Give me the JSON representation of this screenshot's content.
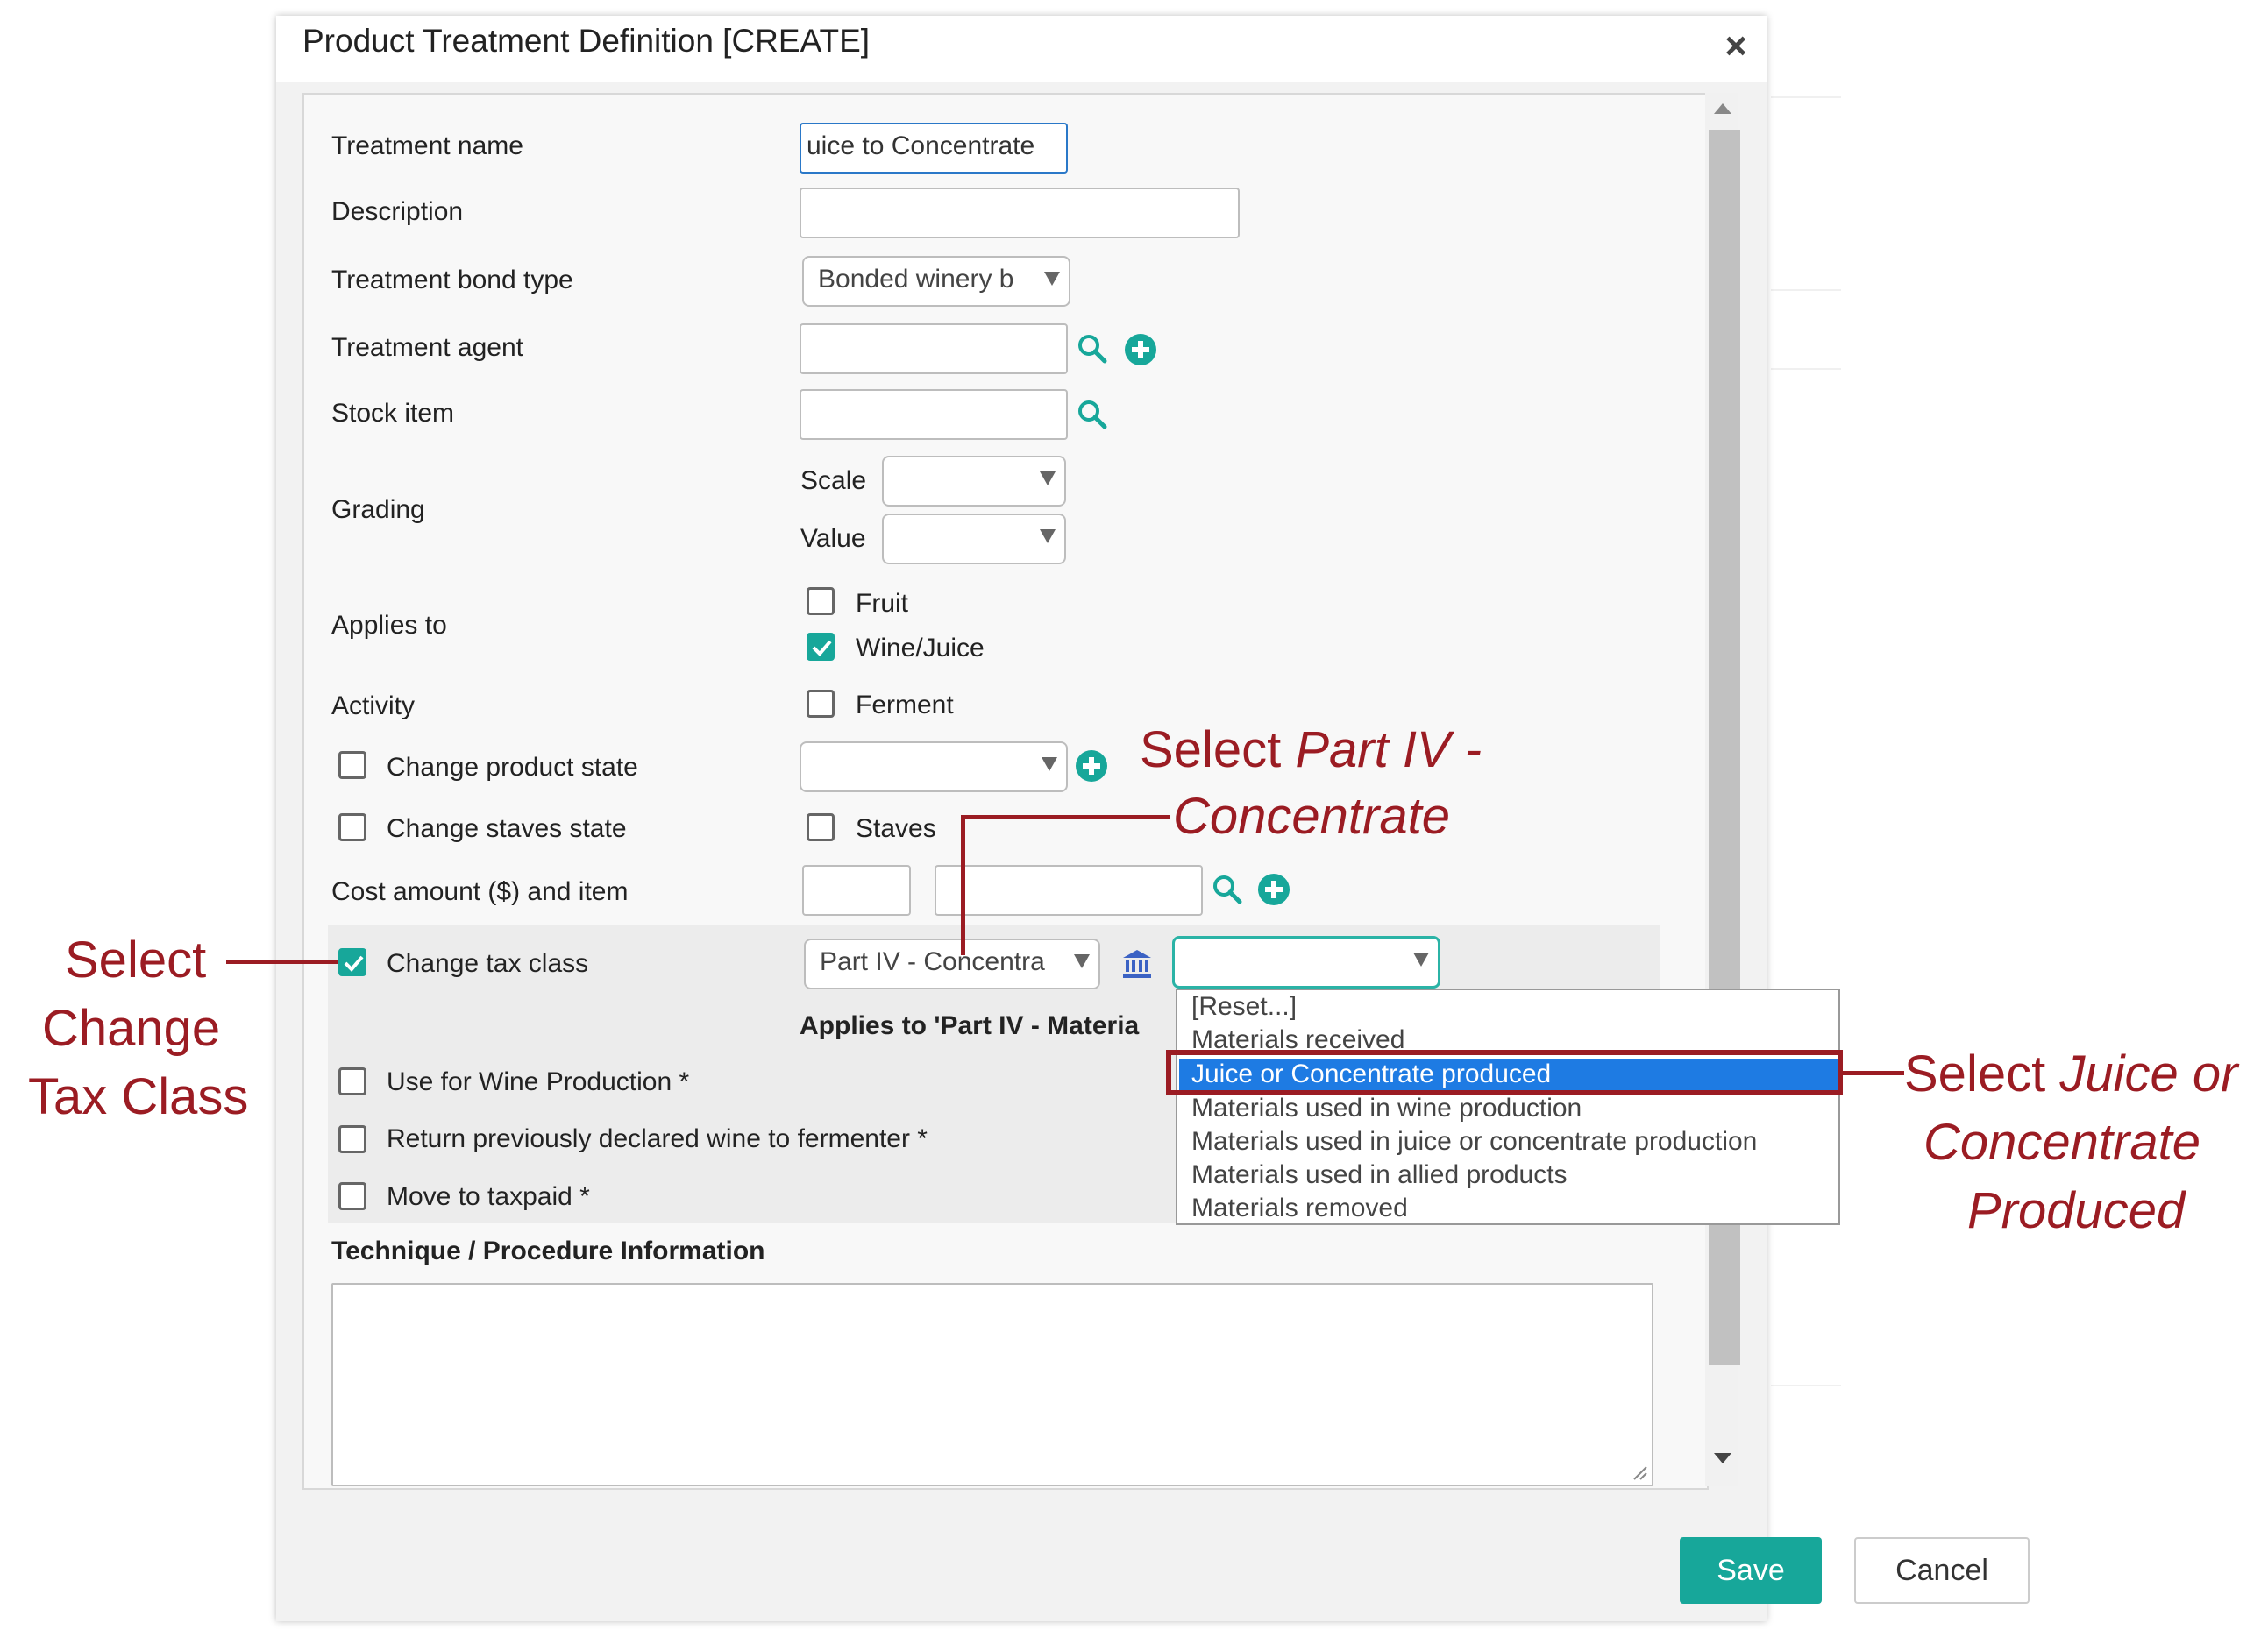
{
  "dialog": {
    "title": "Product Treatment Definition [CREATE]",
    "close_glyph": "×"
  },
  "form": {
    "treatment_name": {
      "label": "Treatment name",
      "value": "uice to Concentrate"
    },
    "description": {
      "label": "Description",
      "value": ""
    },
    "bond_type": {
      "label": "Treatment bond type",
      "value": "Bonded winery b"
    },
    "agent": {
      "label": "Treatment agent",
      "value": ""
    },
    "stock_item": {
      "label": "Stock item",
      "value": ""
    },
    "grading": {
      "label": "Grading",
      "scale_label": "Scale",
      "value_label": "Value",
      "scale_value": "",
      "value_value": ""
    },
    "applies_to": {
      "label": "Applies to",
      "fruit": "Fruit",
      "fruit_checked": false,
      "wine": "Wine/Juice",
      "wine_checked": true
    },
    "activity": {
      "label": "Activity",
      "ferment": "Ferment",
      "ferment_checked": false
    },
    "change_product_state": {
      "label": "Change product state",
      "checked": false,
      "value": ""
    },
    "change_staves_state": {
      "label": "Change staves state",
      "checked": false,
      "staves": "Staves",
      "staves_checked": false
    },
    "cost": {
      "label": "Cost amount ($) and item",
      "amount": "",
      "item": ""
    },
    "tax_class": {
      "label": "Change tax class",
      "checked": true,
      "class_value": "Part IV - Concentra",
      "sub_value": ""
    },
    "applies_note": "Applies to 'Part IV - Materia",
    "wine_production": {
      "label": "Use for Wine Production *",
      "checked": false
    },
    "return_wine": {
      "label": "Return previously declared wine to fermenter *",
      "checked": false
    },
    "taxpaid": {
      "label": "Move to taxpaid *",
      "checked": false
    },
    "technique": {
      "label": "Technique / Procedure Information",
      "value": ""
    }
  },
  "dropdown": {
    "items": [
      "[Reset...]",
      "Materials received",
      "Juice or Concentrate produced",
      "Materials used in wine production",
      "Materials used in juice or concentrate production",
      "Materials used in allied products",
      "Materials removed"
    ],
    "selected_index": 2
  },
  "buttons": {
    "save": "Save",
    "cancel": "Cancel"
  },
  "annotations": {
    "left": [
      "Select",
      "Change",
      "Tax Class"
    ],
    "top_plain": "Select ",
    "top_italic_1": "Part IV -",
    "top_italic_2": "Concentrate",
    "right_plain": "Select ",
    "right_italic_1": "Juice or",
    "right_italic_2": "Concentrate",
    "right_italic_3": "Produced"
  },
  "colors": {
    "accent": "#17a79a",
    "annotation": "#9b1c23",
    "selection": "#1e7be3"
  },
  "icons": [
    "close-icon",
    "search-icon",
    "add-circle-icon",
    "bank-icon",
    "checkmark-icon",
    "caret-down-icon",
    "resize-grip-icon"
  ]
}
